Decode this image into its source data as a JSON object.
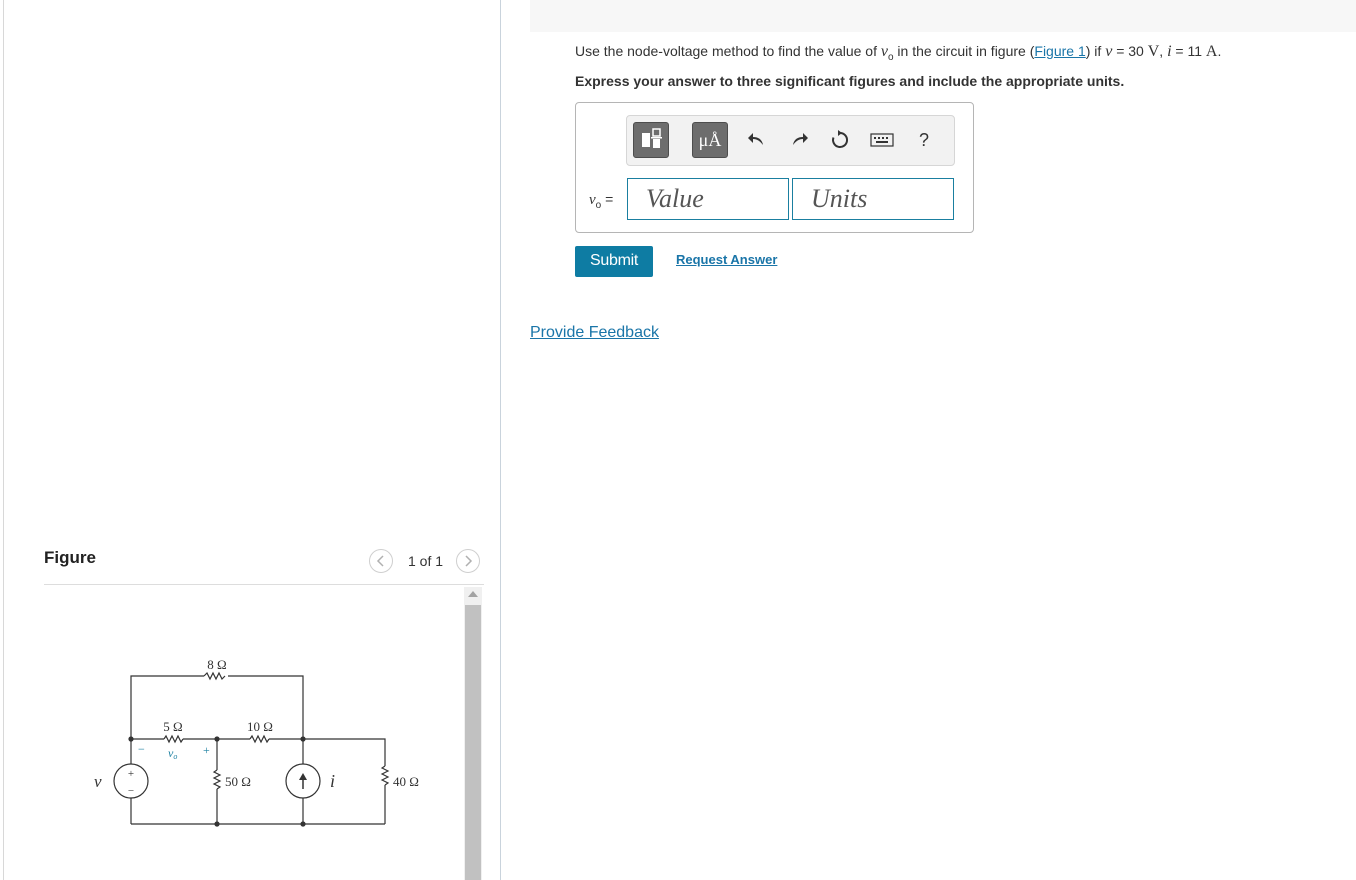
{
  "question": {
    "prefix": "Use the node-voltage method to find the value of ",
    "var_vo": "v",
    "var_vo_sub": "o",
    "mid": " in the circuit in figure (",
    "figure_link": "Figure 1",
    "mid2": ") if ",
    "var_v": "v",
    "eq1": " = 30 ",
    "unit_v": "V",
    "comma": ", ",
    "var_i": "i",
    "eq2": " = 11 ",
    "unit_a": "A",
    "end": "."
  },
  "instruction": "Express your answer to three significant figures and include the appropriate units.",
  "toolbar": {
    "units_button": "μÅ",
    "help": "?"
  },
  "answer": {
    "label_var": "v",
    "label_sub": "o",
    "label_eq": " =",
    "value_placeholder": "Value",
    "units_placeholder": "Units"
  },
  "actions": {
    "submit": "Submit",
    "request_answer": "Request Answer",
    "feedback": "Provide Feedback"
  },
  "figure": {
    "title": "Figure",
    "pager": "1 of 1",
    "circuit": {
      "r_top": "8 Ω",
      "r_left": "5 Ω",
      "r_mid": "10 Ω",
      "r_center": "50 Ω",
      "r_right": "40 Ω",
      "source_v": "v",
      "source_i": "i",
      "vo_label": "v",
      "vo_sub": "o",
      "plus": "+",
      "minus": "−"
    }
  }
}
